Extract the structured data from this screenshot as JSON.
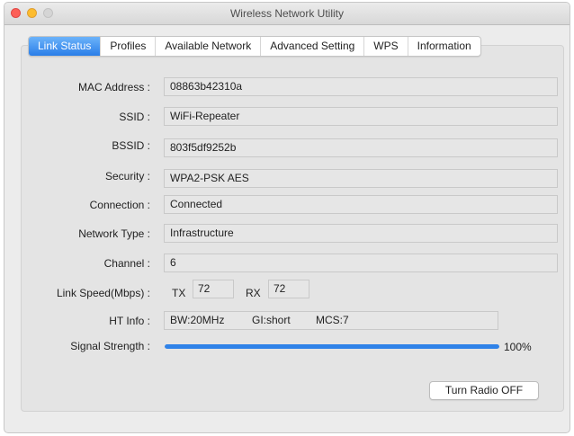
{
  "window": {
    "title": "Wireless Network Utility"
  },
  "tabs": [
    {
      "label": "Link Status",
      "active": true
    },
    {
      "label": "Profiles"
    },
    {
      "label": "Available Network"
    },
    {
      "label": "Advanced Setting"
    },
    {
      "label": "WPS"
    },
    {
      "label": "Information"
    }
  ],
  "fields": {
    "mac": {
      "label": "MAC Address :",
      "value": "08863b42310a"
    },
    "ssid": {
      "label": "SSID :",
      "value": "WiFi-Repeater"
    },
    "bssid": {
      "label": "BSSID :",
      "value": "803f5df9252b"
    },
    "security": {
      "label": "Security :",
      "value": "WPA2-PSK AES"
    },
    "connection": {
      "label": "Connection :",
      "value": "Connected"
    },
    "network_type": {
      "label": "Network Type :",
      "value": "Infrastructure"
    },
    "channel": {
      "label": "Channel :",
      "value": "6"
    }
  },
  "link_speed": {
    "label": "Link Speed(Mbps) :",
    "tx_label": "TX",
    "tx_value": "72",
    "rx_label": "RX",
    "rx_value": "72"
  },
  "ht_info": {
    "label": "HT Info :",
    "bw": "BW:20MHz",
    "gi": "GI:short",
    "mcs": "MCS:7"
  },
  "signal": {
    "label": "Signal Strength :",
    "percent_text": "100%",
    "level": 1.0
  },
  "buttons": {
    "radio": "Turn Radio OFF"
  },
  "colors": {
    "accent": "#2f82e8",
    "tab_active": "#2a7ee8"
  }
}
